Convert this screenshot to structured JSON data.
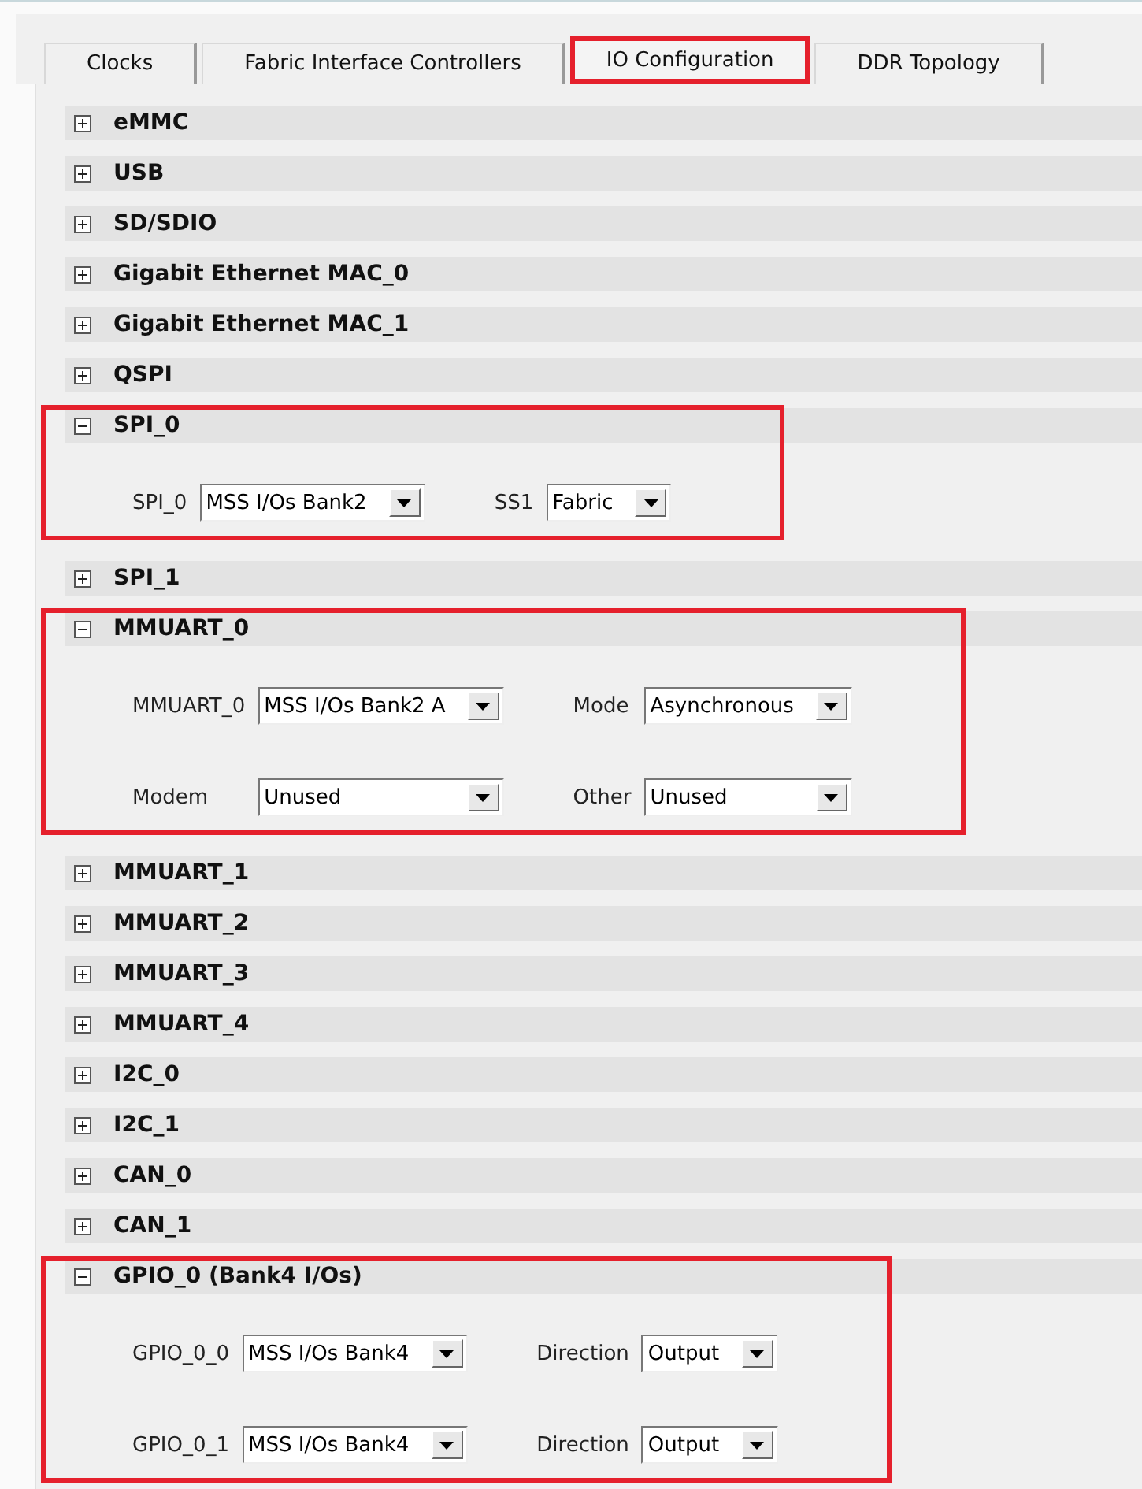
{
  "tabs": [
    {
      "label": "Clocks",
      "selected": false,
      "highlighted": false
    },
    {
      "label": "Fabric Interface Controllers",
      "selected": false,
      "highlighted": false
    },
    {
      "label": "IO Configuration",
      "selected": true,
      "highlighted": true
    },
    {
      "label": "DDR Topology",
      "selected": false,
      "highlighted": false
    }
  ],
  "sections": [
    {
      "title": "eMMC",
      "expanded": false,
      "highlighted": false
    },
    {
      "title": "USB",
      "expanded": false,
      "highlighted": false
    },
    {
      "title": "SD/SDIO",
      "expanded": false,
      "highlighted": false
    },
    {
      "title": "Gigabit Ethernet MAC_0",
      "expanded": false,
      "highlighted": false
    },
    {
      "title": "Gigabit Ethernet MAC_1",
      "expanded": false,
      "highlighted": false
    },
    {
      "title": "QSPI",
      "expanded": false,
      "highlighted": false
    },
    {
      "title": "SPI_0",
      "expanded": true,
      "highlighted": true,
      "rows": [
        [
          {
            "label": "SPI_0",
            "value": "MSS I/Os Bank2"
          },
          {
            "label": "SS1",
            "value": "Fabric"
          }
        ]
      ]
    },
    {
      "title": "SPI_1",
      "expanded": false,
      "highlighted": false
    },
    {
      "title": "MMUART_0",
      "expanded": true,
      "highlighted": true,
      "rows": [
        [
          {
            "label": "MMUART_0",
            "value": "MSS I/Os Bank2 A"
          },
          {
            "label": "Mode",
            "value": "Asynchronous"
          }
        ],
        [
          {
            "label": "Modem",
            "value": "Unused"
          },
          {
            "label": "Other",
            "value": "Unused"
          }
        ]
      ]
    },
    {
      "title": "MMUART_1",
      "expanded": false,
      "highlighted": false
    },
    {
      "title": "MMUART_2",
      "expanded": false,
      "highlighted": false
    },
    {
      "title": "MMUART_3",
      "expanded": false,
      "highlighted": false
    },
    {
      "title": "MMUART_4",
      "expanded": false,
      "highlighted": false
    },
    {
      "title": "I2C_0",
      "expanded": false,
      "highlighted": false
    },
    {
      "title": "I2C_1",
      "expanded": false,
      "highlighted": false
    },
    {
      "title": "CAN_0",
      "expanded": false,
      "highlighted": false
    },
    {
      "title": "CAN_1",
      "expanded": false,
      "highlighted": false
    },
    {
      "title": "GPIO_0 (Bank4 I/Os)",
      "expanded": true,
      "highlighted": true,
      "rows": [
        [
          {
            "label": "GPIO_0_0",
            "value": "MSS I/Os Bank4"
          },
          {
            "label": "Direction",
            "value": "Output"
          }
        ],
        [
          {
            "label": "GPIO_0_1",
            "value": "MSS I/Os Bank4"
          },
          {
            "label": "Direction",
            "value": "Output"
          }
        ]
      ]
    }
  ]
}
